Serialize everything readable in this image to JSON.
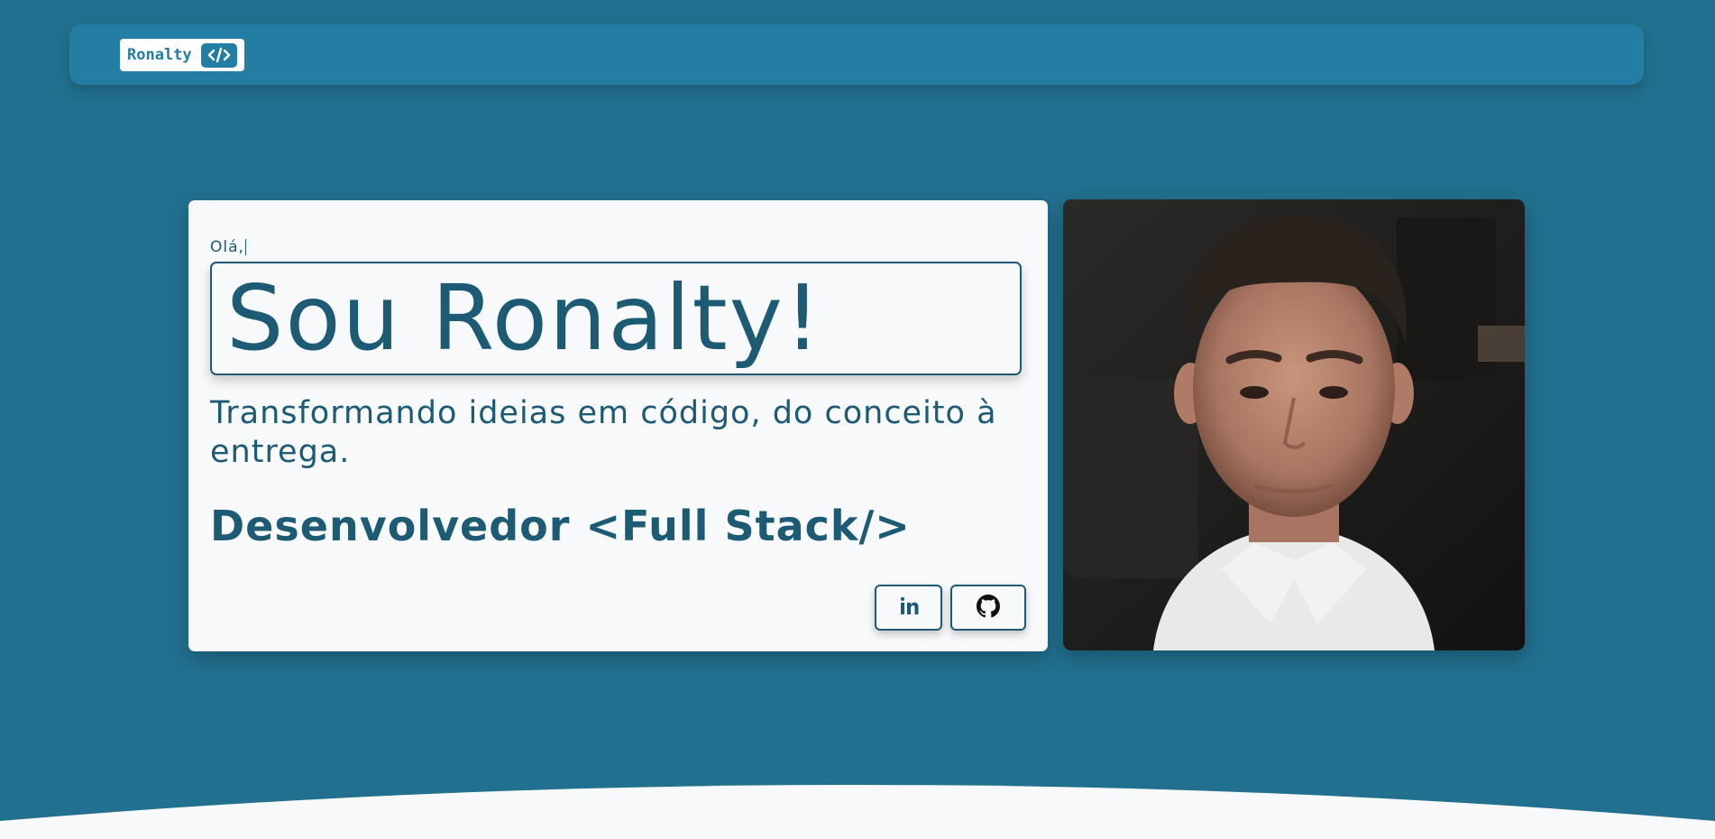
{
  "navbar": {
    "logo_text": "Ronalty",
    "logo_icon": "code-icon"
  },
  "hero": {
    "greeting": "Olá,",
    "name": "Sou Ronalty!",
    "tagline": "Transformando ideias em código, do conceito à entrega.",
    "role": "Desenvolvedor <Full Stack/>",
    "social": [
      {
        "name": "linkedin",
        "icon": "linkedin-icon"
      },
      {
        "name": "github",
        "icon": "github-icon"
      }
    ]
  },
  "photo": {
    "subject": "portrait-photo"
  },
  "colors": {
    "background": "#21708f",
    "navbar": "#247ea3",
    "card": "#f8f9fa",
    "text": "#1d5a73"
  }
}
